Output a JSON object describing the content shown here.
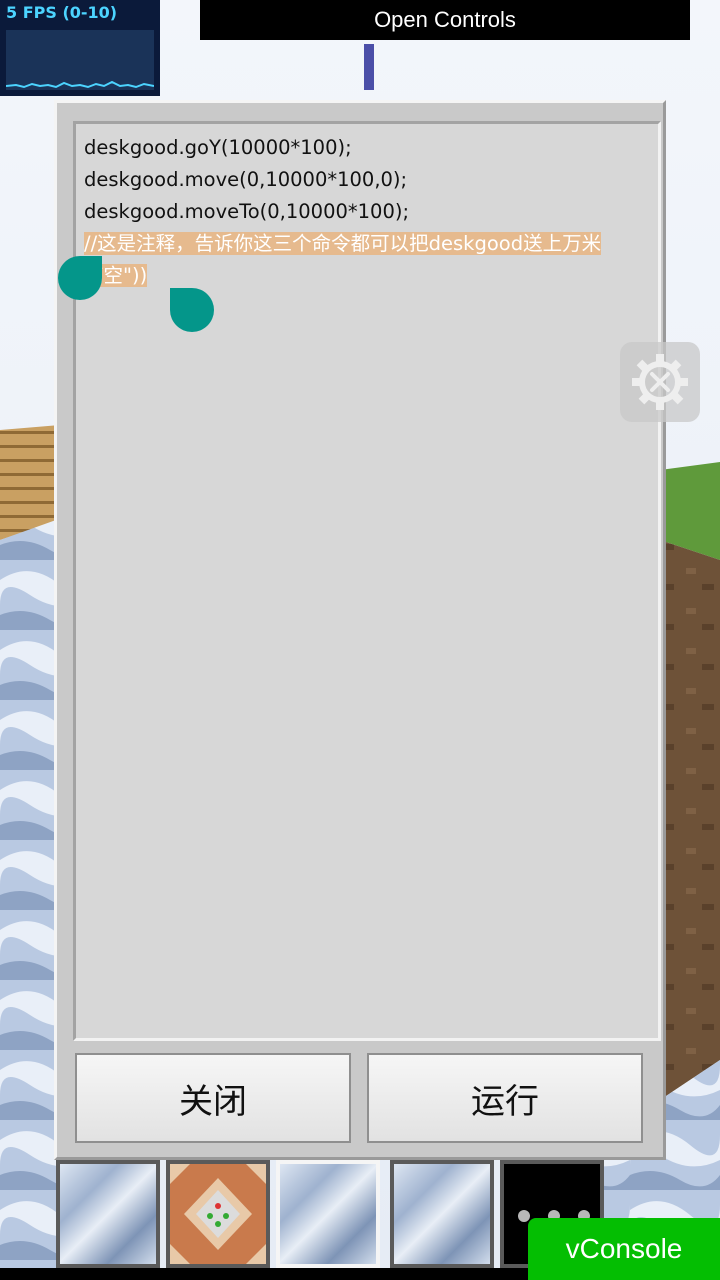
{
  "fps": {
    "label": "5 FPS (0-10)"
  },
  "top_bar": {
    "open_controls_label": "Open Controls"
  },
  "editor": {
    "lines": [
      "deskgood.goY(10000*100);",
      "deskgood.move(0,10000*100,0);",
      "deskgood.moveTo(0,10000*100);"
    ],
    "selected_line_1": "//这是注释，告诉你这三个命令都可以把deskgood送上万米",
    "selected_line_2": "高空\"))",
    "selection_color": "#e6ba8e",
    "handle_color": "#04968a"
  },
  "buttons": {
    "close_label": "关闭",
    "run_label": "运行"
  },
  "settings": {
    "icon": "gear-wrench-icon"
  },
  "hotbar": {
    "slots": [
      "stone",
      "command-block",
      "stone",
      "stone",
      "more"
    ]
  },
  "vconsole": {
    "label": "vConsole",
    "color": "#04be02"
  }
}
